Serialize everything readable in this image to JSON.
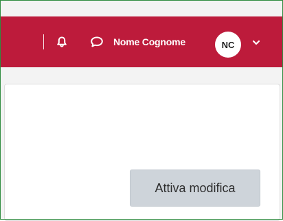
{
  "navbar": {
    "user_name": "Nome Cognome",
    "avatar_initials": "NC",
    "icons": {
      "notifications": "bell-icon",
      "messages": "chat-bubble-icon",
      "user_menu": "chevron-down-icon"
    }
  },
  "main": {
    "edit_button_label": "Attiva modifica"
  },
  "colors": {
    "navbar_bg": "#bd1b3b",
    "frame_border": "#2e8b3e",
    "button_bg": "#ced4da",
    "page_bg": "#f3f3f3"
  }
}
